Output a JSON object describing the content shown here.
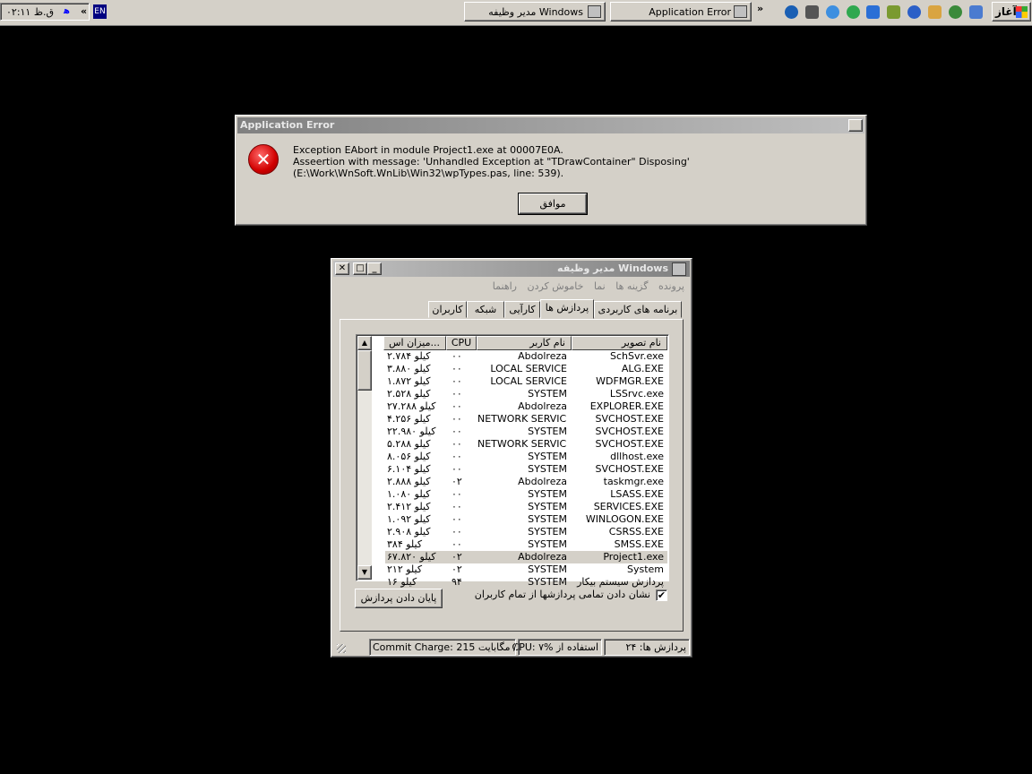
{
  "taskbar": {
    "clock": "۰۲:۱۱ ق.ظ",
    "lang_indicator": "ﻫ",
    "tray_chevron": "«",
    "input_locale": "EN",
    "buttons": [
      {
        "label": "مدیر وظیفه Windows",
        "icon": "taskmgr-icon"
      },
      {
        "label": "Application Error",
        "icon": "error-app-icon"
      }
    ],
    "quicklaunch_chevron": "»",
    "start_label": "آغاز",
    "colors": {
      "face": "#d4d0c8",
      "desktop": "#000000"
    }
  },
  "error_dialog": {
    "title": "Application Error",
    "close_glyph": "✕",
    "message_line1": "Exception EAbort in module Project1.exe at 00007E0A.",
    "message_line2": "Asseertion with message: 'Unhandled Exception at \"TDrawContainer\" Disposing' (E:\\Work\\WnSoft.WnLib\\Win32\\wpTypes.pas, line: 539).",
    "icon_glyph": "✕",
    "ok_label": "موافق"
  },
  "task_manager": {
    "title": "مدیر وظیفه Windows",
    "menu": [
      "پرونده",
      "گزینه ها",
      "نما",
      "خاموش کردن",
      "راهنما"
    ],
    "tabs": [
      "برنامه های کاربردی",
      "پردازش ها",
      "کارآیی",
      "شبکه",
      "کاربران"
    ],
    "active_tab": "پردازش ها",
    "columns": {
      "image": "نام تصویر",
      "user": "نام کاربر",
      "cpu": "CPU",
      "mem": "میزان اس..."
    },
    "processes": [
      {
        "image": "SchSvr.exe",
        "user": "Abdolreza",
        "cpu": "۰۰",
        "mem": "۲.۷۸۴ کیلو"
      },
      {
        "image": "ALG.EXE",
        "user": "LOCAL SERVICE",
        "cpu": "۰۰",
        "mem": "۳.۸۸۰ کیلو"
      },
      {
        "image": "WDFMGR.EXE",
        "user": "LOCAL SERVICE",
        "cpu": "۰۰",
        "mem": "۱.۸۷۲ کیلو"
      },
      {
        "image": "LSSrvc.exe",
        "user": "SYSTEM",
        "cpu": "۰۰",
        "mem": "۲.۵۲۸ کیلو"
      },
      {
        "image": "EXPLORER.EXE",
        "user": "Abdolreza",
        "cpu": "۰۰",
        "mem": "۲۷.۲۸۸ کیلو"
      },
      {
        "image": "SVCHOST.EXE",
        "user": "NETWORK SERVICE",
        "cpu": "۰۰",
        "mem": "۴.۲۵۶ کیلو"
      },
      {
        "image": "SVCHOST.EXE",
        "user": "SYSTEM",
        "cpu": "۰۰",
        "mem": "۲۲.۹۸۰ کیلو"
      },
      {
        "image": "SVCHOST.EXE",
        "user": "NETWORK SERVICE",
        "cpu": "۰۰",
        "mem": "۵.۲۸۸ کیلو"
      },
      {
        "image": "dllhost.exe",
        "user": "SYSTEM",
        "cpu": "۰۰",
        "mem": "۸.۰۵۶ کیلو"
      },
      {
        "image": "SVCHOST.EXE",
        "user": "SYSTEM",
        "cpu": "۰۰",
        "mem": "۶.۱۰۴ کیلو"
      },
      {
        "image": "taskmgr.exe",
        "user": "Abdolreza",
        "cpu": "۰۲",
        "mem": "۲.۸۸۸ کیلو"
      },
      {
        "image": "LSASS.EXE",
        "user": "SYSTEM",
        "cpu": "۰۰",
        "mem": "۱.۰۸۰ کیلو"
      },
      {
        "image": "SERVICES.EXE",
        "user": "SYSTEM",
        "cpu": "۰۰",
        "mem": "۲.۴۱۲ کیلو"
      },
      {
        "image": "WINLOGON.EXE",
        "user": "SYSTEM",
        "cpu": "۰۰",
        "mem": "۱.۰۹۲ کیلو"
      },
      {
        "image": "CSRSS.EXE",
        "user": "SYSTEM",
        "cpu": "۰۰",
        "mem": "۲.۹۰۸ کیلو"
      },
      {
        "image": "SMSS.EXE",
        "user": "SYSTEM",
        "cpu": "۰۰",
        "mem": "۳۸۴ کیلو"
      },
      {
        "image": "Project1.exe",
        "user": "Abdolreza",
        "cpu": "۰۲",
        "mem": "۶۷.۸۲۰ کیلو"
      },
      {
        "image": "System",
        "user": "SYSTEM",
        "cpu": "۰۲",
        "mem": "۲۱۲ کیلو"
      },
      {
        "image": "پردازش سیستم بیکار",
        "user": "SYSTEM",
        "cpu": "۹۴",
        "mem": "۱۶ کیلو"
      }
    ],
    "selected_row": 16,
    "show_all_label": "نشان دادن تمامی پردازشها از تمام کاربران",
    "show_all_checked": "✔",
    "end_process_label": "پایان دادن پردازش",
    "status": {
      "processes": "پردازش ها: ۲۴",
      "cpu": "استفاده از CPU: ۷%",
      "commit": "Commit Charge: 215 مگابایت /"
    }
  }
}
